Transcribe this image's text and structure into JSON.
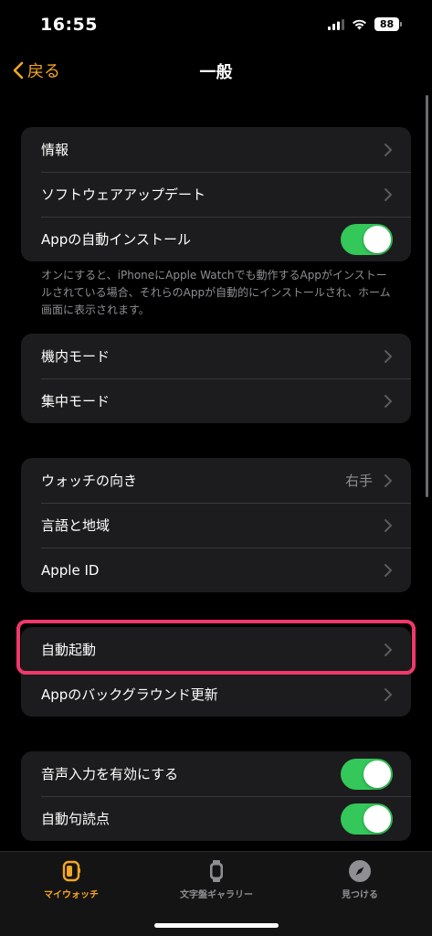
{
  "status": {
    "time": "16:55",
    "battery": "88"
  },
  "nav": {
    "back_label": "戻る",
    "title": "一般"
  },
  "group1": {
    "rows": [
      {
        "label": "情報"
      },
      {
        "label": "ソフトウェアアップデート"
      },
      {
        "label": "Appの自動インストール",
        "toggle": true
      }
    ],
    "footnote": "オンにすると、iPhoneにApple Watchでも動作するAppがインストールされている場合、それらのAppが自動的にインストールされ、ホーム画面に表示されます。"
  },
  "group2": {
    "rows": [
      {
        "label": "機内モード"
      },
      {
        "label": "集中モード"
      }
    ]
  },
  "group3": {
    "rows": [
      {
        "label": "ウォッチの向き",
        "value": "右手"
      },
      {
        "label": "言語と地域"
      },
      {
        "label": "Apple ID"
      }
    ]
  },
  "group4": {
    "rows": [
      {
        "label": "自動起動"
      },
      {
        "label": "Appのバックグラウンド更新"
      }
    ]
  },
  "group5": {
    "rows": [
      {
        "label": "音声入力を有効にする",
        "toggle": true
      },
      {
        "label": "自動句読点",
        "toggle": true
      }
    ]
  },
  "tabs": [
    {
      "label": "マイウォッチ",
      "icon": "watch-face-icon",
      "active": true
    },
    {
      "label": "文字盤ギャラリー",
      "icon": "watch-icon",
      "active": false
    },
    {
      "label": "見つける",
      "icon": "compass-icon",
      "active": false
    }
  ],
  "colors": {
    "accent": "#f5a623",
    "toggle_on": "#34c759",
    "highlight": "#f0386b"
  }
}
